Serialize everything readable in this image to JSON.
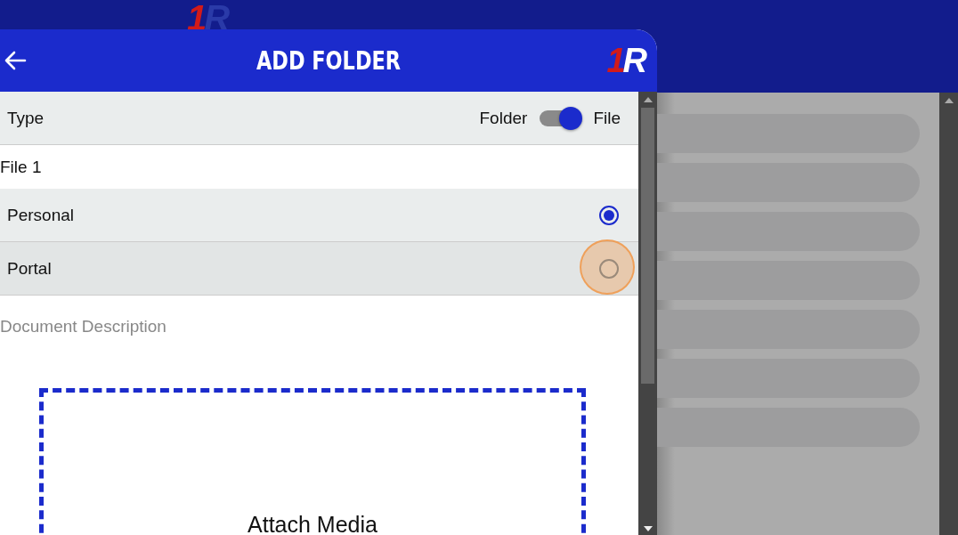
{
  "background_logo": "1R",
  "dialog": {
    "title": "ADD FOLDER",
    "logo": "1R"
  },
  "type_row": {
    "label": "Type",
    "left_option": "Folder",
    "right_option": "File",
    "on": true
  },
  "name_field": {
    "value": "File 1"
  },
  "visibility": [
    {
      "label": "Personal",
      "selected": true,
      "touched": false
    },
    {
      "label": "Portal",
      "selected": false,
      "touched": true
    }
  ],
  "description_field": {
    "placeholder": "Document Description"
  },
  "attach": {
    "label": "Attach Media"
  }
}
